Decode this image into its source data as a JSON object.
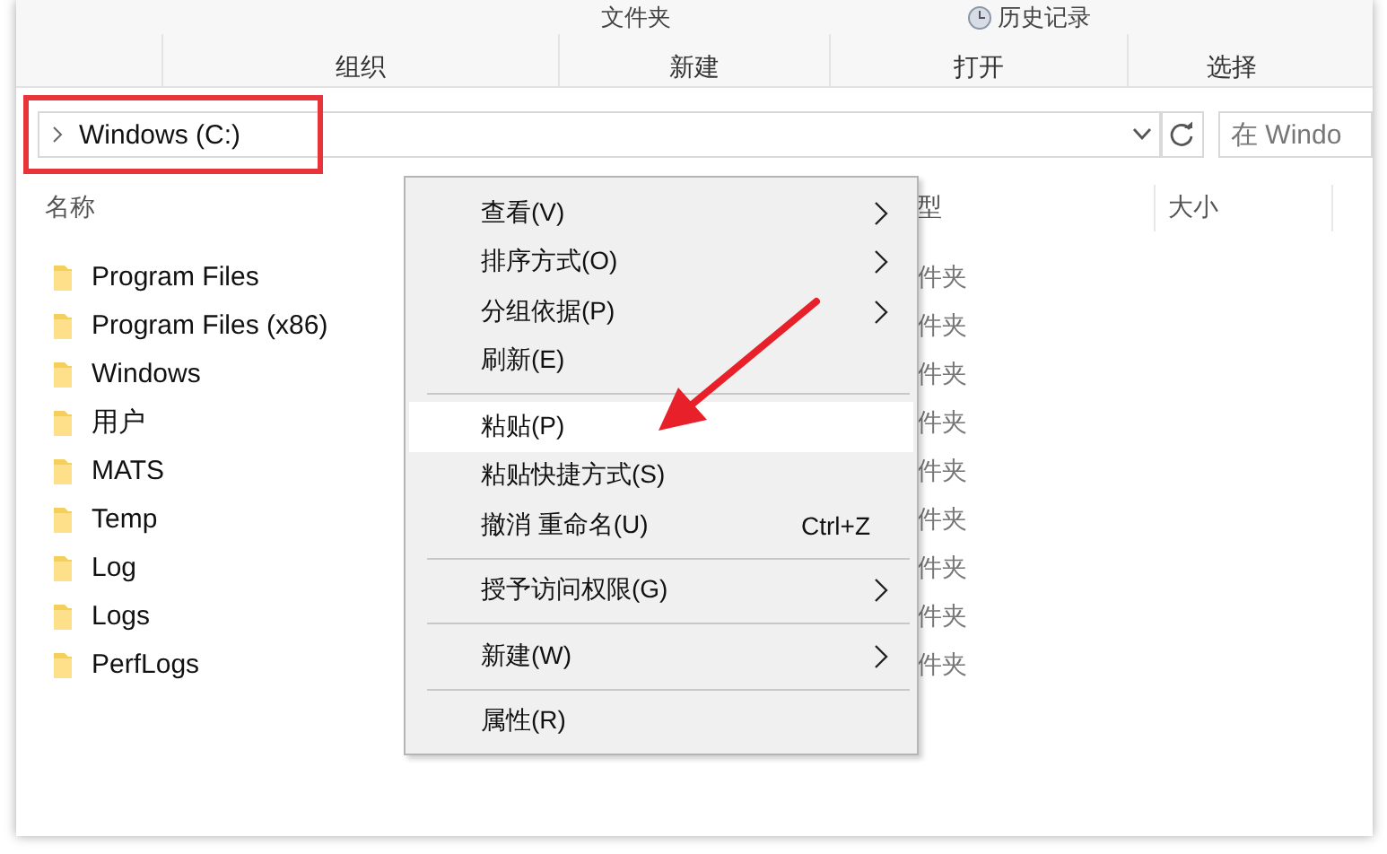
{
  "ribbon": {
    "top_labels": [
      {
        "label": "文件夹",
        "icon": false
      },
      {
        "label": "历史记录",
        "icon": true
      }
    ],
    "groups": [
      "组织",
      "新建",
      "打开",
      "选择"
    ]
  },
  "address_bar": {
    "path": "Windows (C:)",
    "highlighted": true
  },
  "search": {
    "placeholder": "在 Windo"
  },
  "columns": [
    "名称",
    "型",
    "大小"
  ],
  "files": [
    {
      "name": "Program Files",
      "type": "件夹"
    },
    {
      "name": "Program Files (x86)",
      "type": "件夹"
    },
    {
      "name": "Windows",
      "type": "件夹"
    },
    {
      "name": "用户",
      "type": "件夹"
    },
    {
      "name": "MATS",
      "type": "件夹"
    },
    {
      "name": "Temp",
      "type": "件夹"
    },
    {
      "name": "Log",
      "type": "件夹"
    },
    {
      "name": "Logs",
      "type": "件夹"
    },
    {
      "name": "PerfLogs",
      "type": "件夹"
    }
  ],
  "context_menu": {
    "items": [
      {
        "kind": "item",
        "label": "查看(V)",
        "submenu": true,
        "selected": false
      },
      {
        "kind": "item",
        "label": "排序方式(O)",
        "submenu": true,
        "selected": false
      },
      {
        "kind": "item",
        "label": "分组依据(P)",
        "submenu": true,
        "selected": false
      },
      {
        "kind": "item",
        "label": "刷新(E)",
        "submenu": false,
        "selected": false
      },
      {
        "kind": "separator"
      },
      {
        "kind": "item",
        "label": "粘贴(P)",
        "submenu": false,
        "selected": true
      },
      {
        "kind": "item",
        "label": "粘贴快捷方式(S)",
        "submenu": false,
        "selected": false
      },
      {
        "kind": "item",
        "label": "撤消 重命名(U)",
        "shortcut": "Ctrl+Z",
        "submenu": false,
        "selected": false
      },
      {
        "kind": "separator"
      },
      {
        "kind": "item",
        "label": "授予访问权限(G)",
        "submenu": true,
        "selected": false
      },
      {
        "kind": "separator"
      },
      {
        "kind": "item",
        "label": "新建(W)",
        "submenu": true,
        "selected": false
      },
      {
        "kind": "separator"
      },
      {
        "kind": "item",
        "label": "属性(R)",
        "submenu": false,
        "selected": false
      }
    ]
  }
}
